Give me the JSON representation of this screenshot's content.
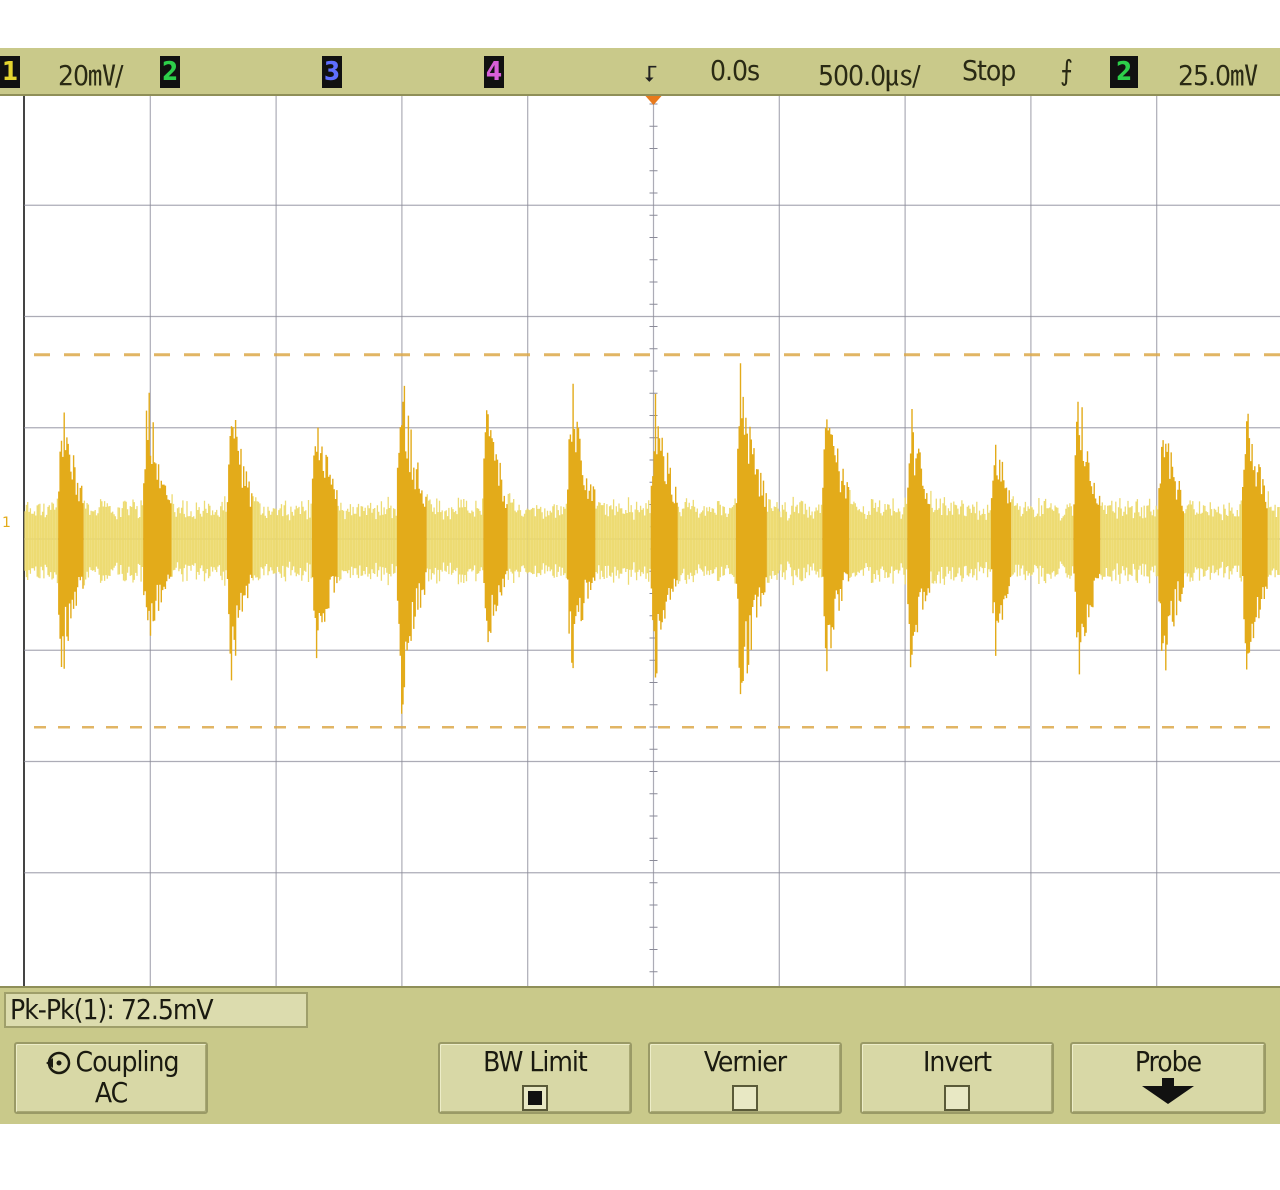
{
  "status_bar": {
    "ch1_label": "1",
    "ch1_scale": "20㎷/",
    "ch2_label": "2",
    "ch3_label": "3",
    "ch4_label": "4",
    "trigger_marker": "⮦",
    "time_delay": "0.0s",
    "time_scale": "500.0㎲/",
    "run_state": "Stop",
    "trigger_edge": "⨍",
    "trigger_source": "2",
    "trigger_level": "25.0㎷"
  },
  "measurement": {
    "pk_pk": "Pk-Pk(1): 72.5mV"
  },
  "softkeys": {
    "coupling_label": "Coupling",
    "coupling_value": "AC",
    "bw_limit_label": "BW Limit",
    "bw_limit_checked": true,
    "vernier_label": "Vernier",
    "vernier_checked": false,
    "invert_label": "Invert",
    "invert_checked": false,
    "probe_label": "Probe"
  },
  "colors": {
    "trace": "#e3ab1a",
    "trace_light": "#ecd96a",
    "grid": "#8a8a98",
    "cursor": "#dca94a",
    "panel": "#c9c98a"
  },
  "waveform": {
    "burst_times_div": [
      0.3,
      0.98,
      1.65,
      2.32,
      3.0,
      3.68,
      4.35,
      5.02,
      5.7,
      6.38,
      7.05,
      7.72,
      8.38,
      9.05,
      9.72
    ],
    "burst_peaks_div": [
      1.55,
      1.7,
      1.5,
      1.48,
      1.82,
      1.5,
      1.7,
      1.6,
      1.9,
      1.65,
      1.38,
      1.18,
      1.6,
      1.38,
      1.5
    ],
    "burst_troughs_div": [
      -1.4,
      -1.25,
      -1.42,
      -1.32,
      -1.8,
      -1.22,
      -1.4,
      -1.45,
      -1.8,
      -1.3,
      -1.38,
      -1.15,
      -1.4,
      -1.5,
      -1.42
    ],
    "cursor_upper_div": 1.8,
    "cursor_lower_div": -1.8
  }
}
